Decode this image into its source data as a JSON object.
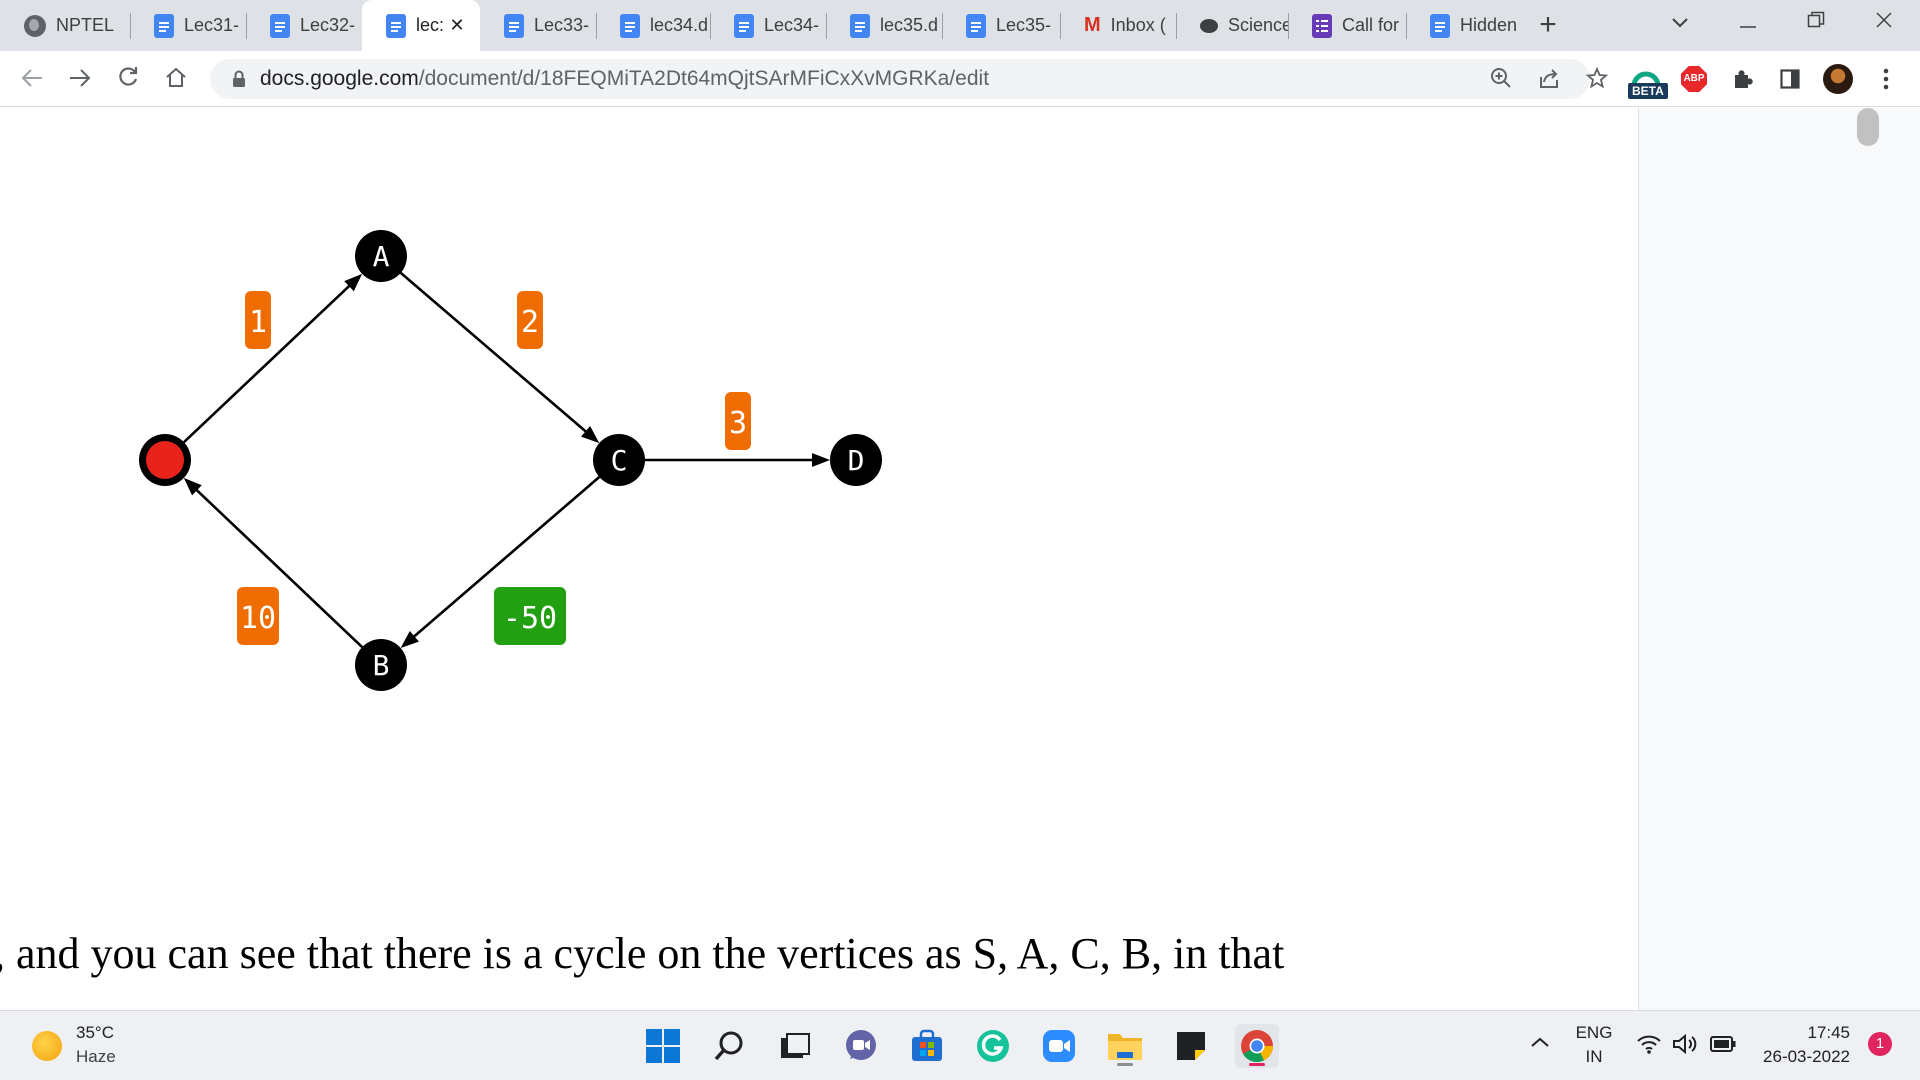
{
  "browser": {
    "tabs": [
      {
        "label": "NPTEL",
        "icon": "globe-icon"
      },
      {
        "label": "Lec31-",
        "icon": "docs-icon"
      },
      {
        "label": "Lec32-",
        "icon": "docs-icon"
      },
      {
        "label": "lec:",
        "icon": "docs-icon",
        "active": true
      },
      {
        "label": "Lec33-",
        "icon": "docs-icon"
      },
      {
        "label": "lec34.d",
        "icon": "docs-icon"
      },
      {
        "label": "Lec34-",
        "icon": "docs-icon"
      },
      {
        "label": "lec35.d",
        "icon": "docs-icon"
      },
      {
        "label": "Lec35-",
        "icon": "docs-icon"
      },
      {
        "label": "Inbox (",
        "icon": "gmail-icon"
      },
      {
        "label": "Science",
        "icon": "chat-icon"
      },
      {
        "label": "Call for",
        "icon": "forms-icon"
      },
      {
        "label": "Hidden",
        "icon": "docs-icon"
      }
    ],
    "tab_close_glyph": "✕",
    "new_tab_glyph": "+",
    "url_host": "docs.google.com",
    "url_path": "/document/d/18FEQMiTA2Dt64mQjtSArMFiCxXvMGRKa/edit",
    "beta_badge": "BETA",
    "abp_label": "ABP"
  },
  "graph": {
    "nodes": [
      {
        "id": "S",
        "label": "",
        "color": "#e8231b"
      },
      {
        "id": "A",
        "label": "A",
        "color": "#000000"
      },
      {
        "id": "B",
        "label": "B",
        "color": "#000000"
      },
      {
        "id": "C",
        "label": "C",
        "color": "#000000"
      },
      {
        "id": "D",
        "label": "D",
        "color": "#000000"
      }
    ],
    "edges": [
      {
        "from": "S",
        "to": "A",
        "weight": "1",
        "color": "#ef6c00"
      },
      {
        "from": "A",
        "to": "C",
        "weight": "2",
        "color": "#ef6c00"
      },
      {
        "from": "C",
        "to": "D",
        "weight": "3",
        "color": "#ef6c00"
      },
      {
        "from": "C",
        "to": "B",
        "weight": "-50",
        "color": "#22a012"
      },
      {
        "from": "B",
        "to": "S",
        "weight": "10",
        "color": "#ef6c00"
      }
    ]
  },
  "document": {
    "caption": ", and you can see that there is a cycle on the vertices as S, A, C, B, in that"
  },
  "taskbar": {
    "weather_temp": "35°C",
    "weather_desc": "Haze",
    "lang_primary": "ENG",
    "lang_secondary": "IN",
    "time": "17:45",
    "date": "26-03-2022",
    "notification_count": "1"
  }
}
